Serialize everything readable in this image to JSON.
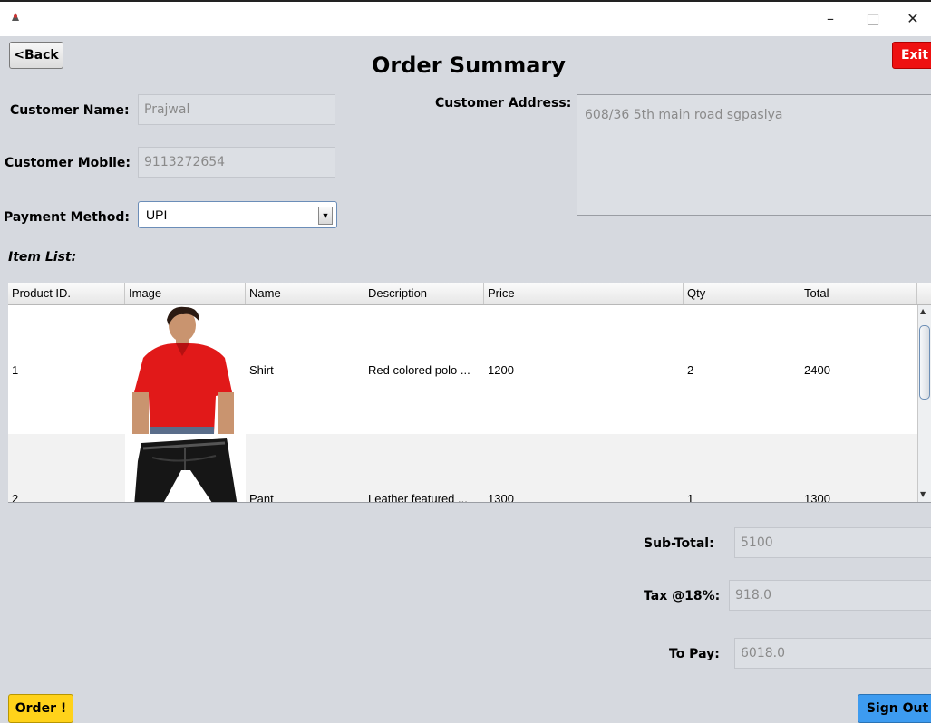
{
  "window": {
    "minimize": "–",
    "maximize": "□",
    "close": "✕"
  },
  "buttons": {
    "back": "<Back",
    "exit": "Exit",
    "order": "Order !",
    "sign_out": "Sign Out"
  },
  "page_title": "Order Summary",
  "customer": {
    "name_label": "Customer Name:",
    "name_value": "Prajwal",
    "mobile_label": "Customer Mobile:",
    "mobile_value": "9113272654",
    "address_label": "Customer Address:",
    "address_value": "608/36 5th main road sgpaslya",
    "payment_label": "Payment Method:",
    "payment_value": "UPI"
  },
  "item_list_label": "Item List:",
  "table": {
    "columns": [
      "Product ID.",
      "Image",
      "Name",
      "Description",
      "Price",
      "Qty",
      "Total"
    ],
    "rows": [
      {
        "id": "1",
        "name": "Shirt",
        "description": "Red colored polo ...",
        "price": "1200",
        "qty": "2",
        "total": "2400"
      },
      {
        "id": "2",
        "name": "Pant",
        "description": "Leather featured ...",
        "price": "1300",
        "qty": "1",
        "total": "1300"
      }
    ]
  },
  "summary": {
    "subtotal_label": "Sub-Total:",
    "subtotal_value": "5100",
    "tax_label": "Tax @18%:",
    "tax_value": "918.0",
    "topay_label": "To Pay:",
    "topay_value": "6018.0"
  },
  "colors": {
    "exit": "#ee1111",
    "order": "#ffd21a",
    "sign_out": "#3d9bf0",
    "background": "#d6d9df"
  }
}
